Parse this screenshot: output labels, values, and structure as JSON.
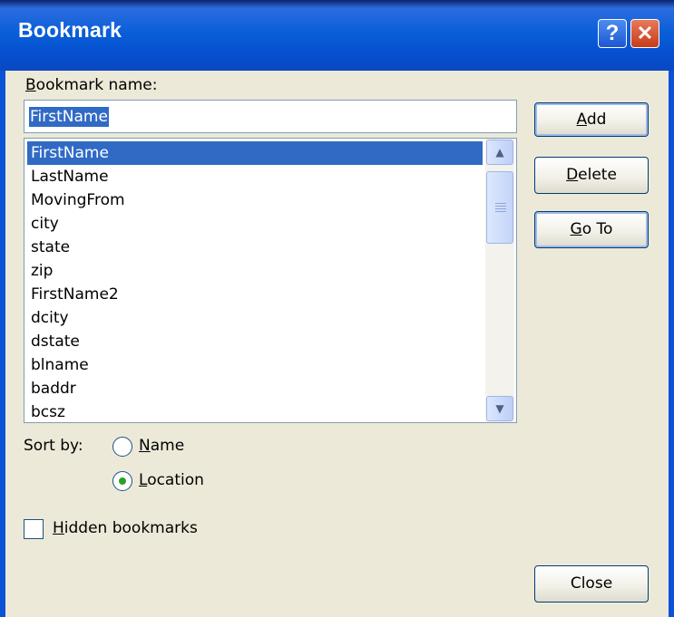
{
  "window": {
    "title": "Bookmark",
    "help_glyph": "?",
    "close_glyph": "✕"
  },
  "name_field": {
    "label_accel": "B",
    "label_rest": "ookmark name:",
    "value": "FirstName"
  },
  "bookmark_list": {
    "selected_index": 0,
    "items": [
      "FirstName",
      "LastName",
      "MovingFrom",
      "city",
      "state",
      "zip",
      "FirstName2",
      "dcity",
      "dstate",
      "blname",
      "baddr",
      "bcsz"
    ]
  },
  "scrollbar": {
    "up_glyph": "▲",
    "down_glyph": "▼"
  },
  "buttons": {
    "add": {
      "accel": "A",
      "rest": "dd"
    },
    "delete": {
      "accel": "D",
      "rest": "elete"
    },
    "goto": {
      "accel": "G",
      "rest": "o To"
    },
    "close": {
      "label": "Close"
    }
  },
  "sort": {
    "label": "Sort by:",
    "selected": "Location",
    "name": {
      "accel": "N",
      "rest": "ame"
    },
    "location": {
      "accel": "L",
      "rest": "ocation"
    }
  },
  "hidden_bookmarks": {
    "checked": false,
    "accel": "H",
    "rest": "idden bookmarks"
  },
  "colors": {
    "title_bar": "#0a53d6",
    "selection": "#316ac5",
    "dialog_bg": "#ece9d8",
    "radio_dot": "#2ba02b"
  }
}
